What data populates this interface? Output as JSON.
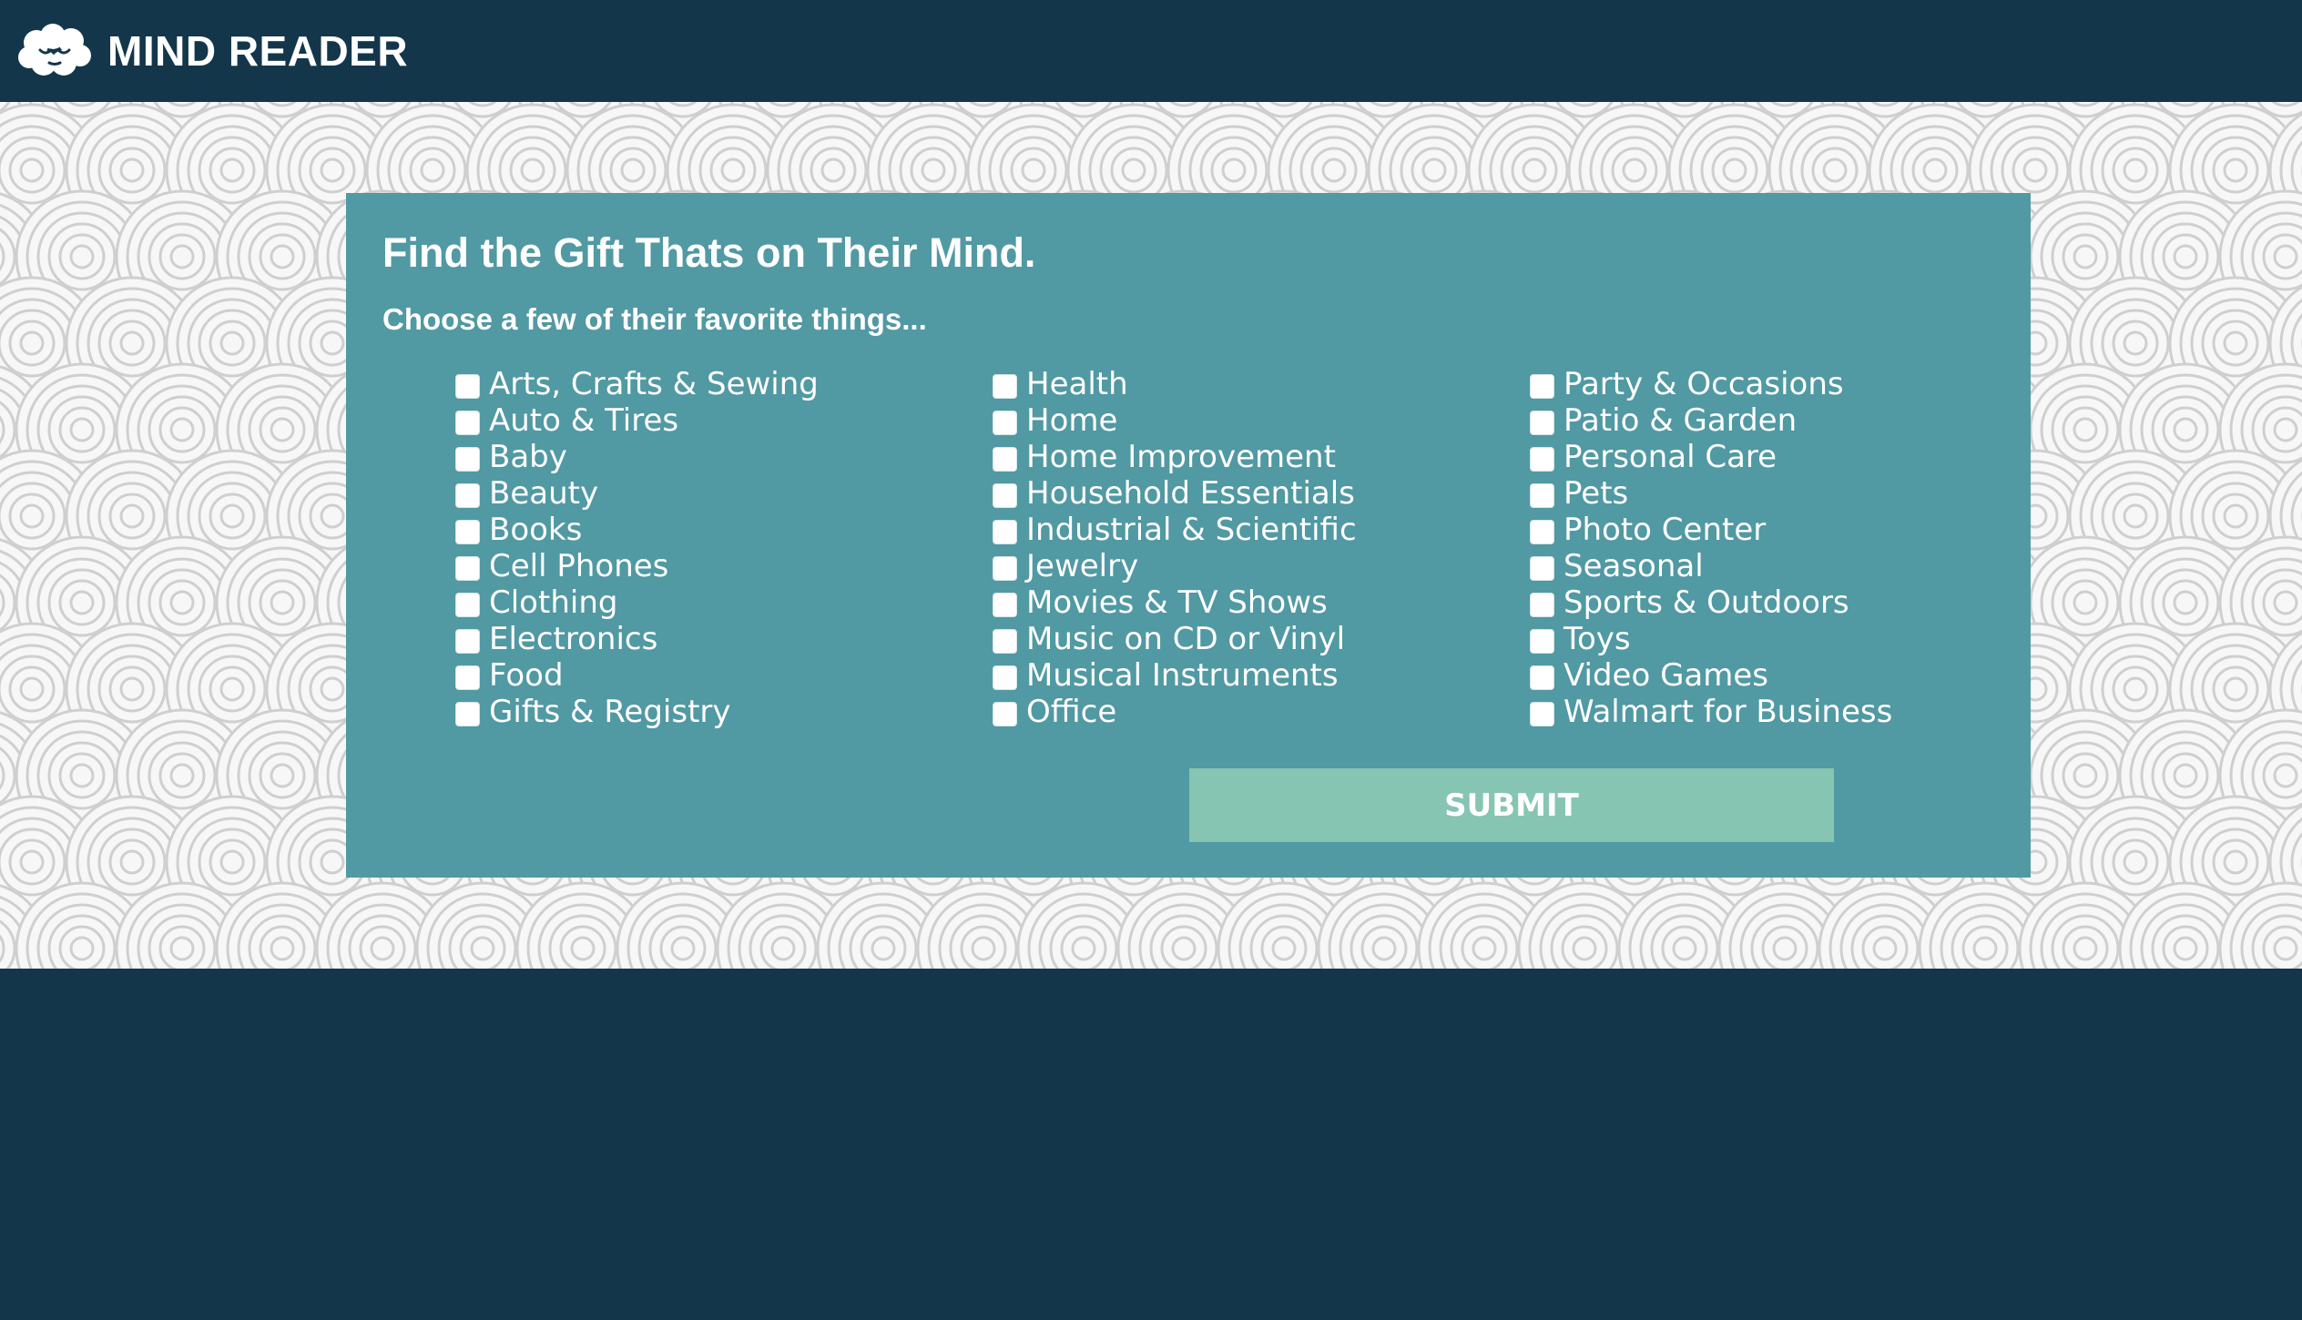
{
  "navbar": {
    "brand_name": "MIND READER",
    "logo_icon": "sleeping-brain-cloud-icon"
  },
  "form": {
    "headline": "Find the Gift Thats on Their Mind.",
    "subhead": "Choose a few of their favorite things...",
    "columns": [
      [
        "Arts, Crafts & Sewing",
        "Auto & Tires",
        "Baby",
        "Beauty",
        "Books",
        "Cell Phones",
        "Clothing",
        "Electronics",
        "Food",
        "Gifts & Registry"
      ],
      [
        "Health",
        "Home",
        "Home Improvement",
        "Household Essentials",
        "Industrial & Scientific",
        "Jewelry",
        "Movies & TV Shows",
        "Music on CD or Vinyl",
        "Musical Instruments",
        "Office"
      ],
      [
        "Party & Occasions",
        "Patio & Garden",
        "Personal Care",
        "Pets",
        "Photo Center",
        "Seasonal",
        "Sports & Outdoors",
        "Toys",
        "Video Games",
        "Walmart for Business"
      ]
    ],
    "submit_label": "SUBMIT"
  },
  "colors": {
    "navbar_bg": "#13364b",
    "panel_bg": "#5199a3",
    "submit_bg": "#86c5b2",
    "pattern_bg": "#f2f2f2",
    "pattern_stroke": "#cfcfcf"
  }
}
